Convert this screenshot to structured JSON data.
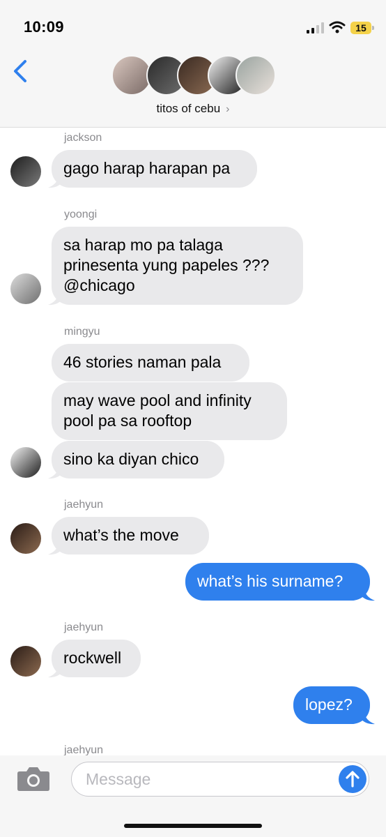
{
  "status": {
    "time": "10:09",
    "battery": "15"
  },
  "header": {
    "group_name": "titos of cebu",
    "chevron": "›"
  },
  "messages": [
    {
      "sender": "jackson",
      "text_lines": [
        "gago harap harapan pa"
      ]
    },
    {
      "sender": "yoongi",
      "text_lines": [
        "sa harap mo pa talaga",
        "prinesenta yung papeles ???",
        "@chicago"
      ]
    },
    {
      "sender": "mingyu",
      "text_lines": [
        "46 stories naman pala"
      ]
    },
    {
      "text_lines": [
        "may wave pool and infinity",
        "pool pa sa rooftop"
      ]
    },
    {
      "text_lines": [
        "sino ka diyan chico"
      ]
    },
    {
      "sender": "jaehyun",
      "text_lines": [
        "what’s the move"
      ]
    },
    {
      "outgoing": true,
      "text_lines": [
        "what’s his surname?"
      ]
    },
    {
      "sender": "jaehyun",
      "text_lines": [
        "rockwell"
      ]
    },
    {
      "outgoing": true,
      "text_lines": [
        "lopez?"
      ]
    },
    {
      "sender": "jaehyun"
    }
  ],
  "input": {
    "placeholder": "Message"
  },
  "colors": {
    "incoming_bubble": "#e9e9eb",
    "outgoing_bubble": "#2f80ed",
    "accent": "#2f80ed"
  }
}
